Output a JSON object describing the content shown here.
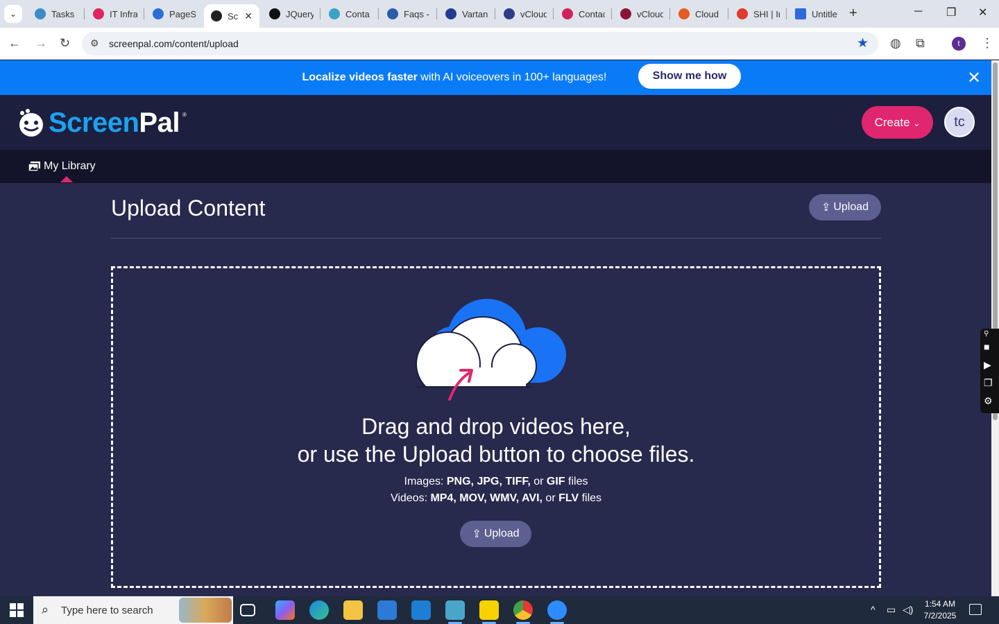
{
  "browser": {
    "tabs": [
      {
        "label": "Tasks",
        "color": "#3c8bc7"
      },
      {
        "label": "IT Infra",
        "color": "#e0245e"
      },
      {
        "label": "PageSp",
        "color": "#2b6fd6"
      },
      {
        "label": "Sc",
        "color": "#222222"
      },
      {
        "label": "JQuery",
        "color": "#111111"
      },
      {
        "label": "Conta",
        "color": "#3aa3c4"
      },
      {
        "label": "Faqs -",
        "color": "#2a5ca8"
      },
      {
        "label": "Vartan",
        "color": "#223a8f"
      },
      {
        "label": "vCloud",
        "color": "#2d3b88"
      },
      {
        "label": "Contac",
        "color": "#d0225a"
      },
      {
        "label": "vCloud",
        "color": "#8a1538"
      },
      {
        "label": "Cloud",
        "color": "#e55b25"
      },
      {
        "label": "SHI | In",
        "color": "#e23b2e"
      },
      {
        "label": "Untitle",
        "color": "#2f6ad9"
      }
    ],
    "url": "screenpal.com/content/upload"
  },
  "promo": {
    "bold": "Localize videos faster",
    "rest": " with AI voiceovers in 100+ languages!",
    "button": "Show me how"
  },
  "header": {
    "logo_screen": "Screen",
    "logo_pal": "Pal",
    "logo_reg": "®",
    "create": "Create",
    "avatar": "tc"
  },
  "nav": {
    "library": "My Library"
  },
  "main": {
    "title": "Upload Content",
    "upload_label": "Upload",
    "drop_line1": "Drag and drop videos here,",
    "drop_line2": "or use the Upload button to choose files.",
    "images_prefix": "Images: ",
    "images_types": "PNG, JPG, TIFF,",
    "images_or": " or ",
    "images_last": "GIF",
    "images_suffix": " files",
    "videos_prefix": "Videos: ",
    "videos_types": "MP4, MOV, WMV, AVI,",
    "videos_or": " or ",
    "videos_last": "FLV",
    "videos_suffix": " files"
  },
  "taskbar": {
    "search_placeholder": "Type here to search",
    "time": "1:54 AM",
    "date": "7/2/2025"
  },
  "colors": {
    "brand_pink": "#e0266e",
    "promo_blue": "#0a7bf7",
    "page_bg": "#27294d"
  }
}
